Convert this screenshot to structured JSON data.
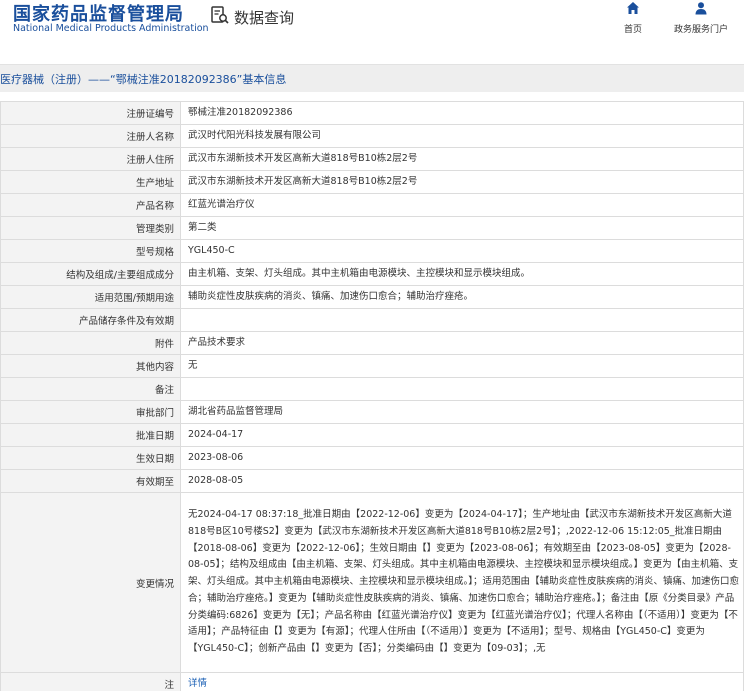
{
  "header": {
    "brand_cn": "国家药品监督管理局",
    "brand_en": "National Medical Products Administration",
    "query_label": "数据查询",
    "nav_home": "首页",
    "nav_service": "政务服务门户"
  },
  "title": "医疗器械（注册）——“鄂械注准20182092386”基本信息",
  "rows": [
    {
      "label": "注册证编号",
      "value": "鄂械注准20182092386"
    },
    {
      "label": "注册人名称",
      "value": "武汉时代阳光科技发展有限公司"
    },
    {
      "label": "注册人住所",
      "value": "武汉市东湖新技术开发区高新大道818号B10栋2层2号"
    },
    {
      "label": "生产地址",
      "value": "武汉市东湖新技术开发区高新大道818号B10栋2层2号"
    },
    {
      "label": "产品名称",
      "value": "红蓝光谱治疗仪"
    },
    {
      "label": "管理类别",
      "value": "第二类"
    },
    {
      "label": "型号规格",
      "value": "YGL450-C"
    },
    {
      "label": "结构及组成/主要组成成分",
      "value": "由主机箱、支架、灯头组成。其中主机箱由电源模块、主控模块和显示模块组成。"
    },
    {
      "label": "适用范围/预期用途",
      "value": "辅助炎症性皮肤疾病的消炎、镇痛、加速伤口愈合；辅助治疗痤疮。"
    },
    {
      "label": "产品储存条件及有效期",
      "value": ""
    },
    {
      "label": "附件",
      "value": "产品技术要求"
    },
    {
      "label": "其他内容",
      "value": "无"
    },
    {
      "label": "备注",
      "value": ""
    },
    {
      "label": "审批部门",
      "value": "湖北省药品监督管理局"
    },
    {
      "label": "批准日期",
      "value": "2024-04-17"
    },
    {
      "label": "生效日期",
      "value": "2023-08-06"
    },
    {
      "label": "有效期至",
      "value": "2028-08-05"
    }
  ],
  "change": {
    "label": "变更情况",
    "text": "无2024-04-17 08:37:18_批准日期由【2022-12-06】变更为【2024-04-17】；生产地址由【武汉市东湖新技术开发区高新大道818号B区10号楼S2】变更为【武汉市东湖新技术开发区高新大道818号B10栋2层2号】；,2022-12-06 15:12:05_批准日期由【2018-08-06】变更为【2022-12-06】；生效日期由【】变更为【2023-08-06】；有效期至由【2023-08-05】变更为【2028-08-05】；结构及组成由【由主机箱、支架、灯头组成。其中主机箱由电源模块、主控模块和显示模块组成。】变更为【由主机箱、支架、灯头组成。其中主机箱由电源模块、主控模块和显示模块组成。】；适用范围由【辅助炎症性皮肤疾病的消炎、镇痛、加速伤口愈合；辅助治疗痤疮。】变更为【辅助炎症性皮肤疾病的消炎、镇痛、加速伤口愈合；辅助治疗痤疮。】；备注由【原《分类目录》产品分类编码:6826】变更为【无】；产品名称由【红蓝光谱治疗仪】变更为【红蓝光谱治疗仪】；代理人名称由【（不适用）】变更为【不适用】；产品特征由【】变更为【有源】；代理人住所由【（不适用）】变更为【不适用】；型号、规格由【YGL450-C】变更为【YGL450-C】；创新产品由【】变更为【否】；分类编码由【】变更为【09-03】；,无"
  },
  "note": {
    "label": "注",
    "link": "详情"
  },
  "colors": {
    "brand": "#1a4f9c",
    "link": "#1a5fb4",
    "label_bg": "#f3f3f3",
    "title_bg": "#eeeeee"
  }
}
